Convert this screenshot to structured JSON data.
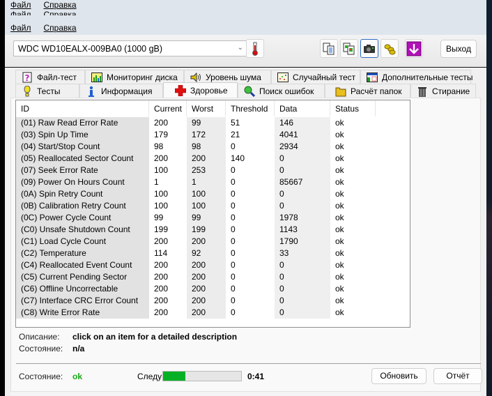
{
  "menu": {
    "file": "Файл",
    "help": "Справка"
  },
  "toolbar": {
    "drive": "WDC WD10EALX-009BA0 (1000 gB)",
    "icons": [
      "thermometer-icon",
      "copy-text-icon",
      "copy-image-icon",
      "camera-icon",
      "coins-icon",
      "download-arrow-icon"
    ],
    "exit_label": "Выход"
  },
  "tabs": {
    "top": [
      {
        "label": "Файл-тест",
        "icon": "file-test-icon"
      },
      {
        "label": "Мониторинг диска",
        "icon": "disk-monitor-icon"
      },
      {
        "label": "Уровень шума",
        "icon": "speaker-icon"
      },
      {
        "label": "Случайный тест",
        "icon": "random-test-icon"
      },
      {
        "label": "Дополнительные тесты",
        "icon": "extra-tests-icon"
      }
    ],
    "bottom": [
      {
        "label": "Тесты",
        "icon": "exclamation-icon"
      },
      {
        "label": "Информация",
        "icon": "info-icon"
      },
      {
        "label": "Здоровье",
        "icon": "health-cross-icon",
        "active": true
      },
      {
        "label": "Поиск ошибок",
        "icon": "magnifier-icon"
      },
      {
        "label": "Расчёт папок",
        "icon": "folder-icon"
      },
      {
        "label": "Стирание",
        "icon": "trash-icon"
      }
    ]
  },
  "smart_table": {
    "columns": [
      "ID",
      "Current",
      "Worst",
      "Threshold",
      "Data",
      "Status"
    ],
    "rows": [
      [
        "(01) Raw Read Error Rate",
        "200",
        "99",
        "51",
        "146",
        "ok"
      ],
      [
        "(03) Spin Up Time",
        "179",
        "172",
        "21",
        "4041",
        "ok"
      ],
      [
        "(04) Start/Stop Count",
        "98",
        "98",
        "0",
        "2934",
        "ok"
      ],
      [
        "(05) Reallocated Sector Count",
        "200",
        "200",
        "140",
        "0",
        "ok"
      ],
      [
        "(07) Seek Error Rate",
        "100",
        "253",
        "0",
        "0",
        "ok"
      ],
      [
        "(09) Power On Hours Count",
        "1",
        "1",
        "0",
        "85667",
        "ok"
      ],
      [
        "(0A) Spin Retry Count",
        "100",
        "100",
        "0",
        "0",
        "ok"
      ],
      [
        "(0B) Calibration Retry Count",
        "100",
        "100",
        "0",
        "0",
        "ok"
      ],
      [
        "(0C) Power Cycle Count",
        "99",
        "99",
        "0",
        "1978",
        "ok"
      ],
      [
        "(C0) Unsafe Shutdown Count",
        "199",
        "199",
        "0",
        "1143",
        "ok"
      ],
      [
        "(C1) Load Cycle Count",
        "200",
        "200",
        "0",
        "1790",
        "ok"
      ],
      [
        "(C2) Temperature",
        "114",
        "92",
        "0",
        "33",
        "ok"
      ],
      [
        "(C4) Reallocated Event Count",
        "200",
        "200",
        "0",
        "0",
        "ok"
      ],
      [
        "(C5) Current Pending Sector",
        "200",
        "200",
        "0",
        "0",
        "ok"
      ],
      [
        "(C6) Offline Uncorrectable",
        "200",
        "200",
        "0",
        "0",
        "ok"
      ],
      [
        "(C7) Interface CRC Error Count",
        "200",
        "200",
        "0",
        "0",
        "ok"
      ],
      [
        "(C8) Write Error Rate",
        "200",
        "200",
        "0",
        "0",
        "ok"
      ]
    ]
  },
  "details": {
    "description_label": "Описание:",
    "description_value": "click on an item for a detailed description",
    "state_label": "Состояние:",
    "state_value": "n/a"
  },
  "footer": {
    "state_label": "Состояние:",
    "state_value": "ok",
    "state_color": "#16a816",
    "next_label": "Следующий",
    "progress_percent": 29,
    "progress_color": "#06b025",
    "timer": "0:41",
    "refresh_label": "Обновить",
    "report_label": "Отчёт"
  }
}
